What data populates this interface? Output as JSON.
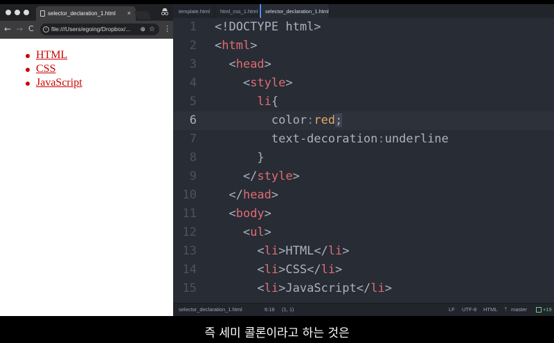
{
  "browser": {
    "tab_title": "selector_declaration_1.html",
    "tab_close": "×",
    "url": "file:///Users/egoing/Dropbox/...",
    "nav_back": "←",
    "nav_forward": "→",
    "nav_reload": "C",
    "menu": "⋮",
    "list_items": [
      "HTML",
      "CSS",
      "JavaScript"
    ],
    "link_color": "#cc0000"
  },
  "editor": {
    "tabs": [
      "template.html",
      "html_css_1.html",
      "selector_declaration_1.html"
    ],
    "active_tab": 2,
    "line_numbers": [
      "1",
      "2",
      "3",
      "4",
      "5",
      "6",
      "7",
      "8",
      "9",
      "10",
      "11",
      "12",
      "13",
      "14",
      "15"
    ],
    "current_line": 6,
    "lines": [
      "<!DOCTYPE html>",
      "<html>",
      "  <head>",
      "    <style>",
      "      li{",
      "        color:red;",
      "        text-decoration:underline",
      "      }",
      "    </style>",
      "  </head>",
      "  <body>",
      "    <ul>",
      "      <li>HTML</li>",
      "      <li>CSS</li>",
      "      <li>JavaScript</li>"
    ],
    "status": {
      "file": "selector_declaration_1.html",
      "cursor": "6:18",
      "selection": "(1, 1)",
      "eol": "LF",
      "encoding": "UTF-8",
      "grammar": "HTML",
      "branch": "master",
      "changes": "+19"
    }
  },
  "subtitle": "즉 세미 콜론이라고 하는 것은",
  "colors": {
    "editor_bg": "#282c34",
    "tag": "#e06c75",
    "value": "#e5a76b",
    "text": "#abb2bf",
    "line_number": "#4b5263"
  }
}
